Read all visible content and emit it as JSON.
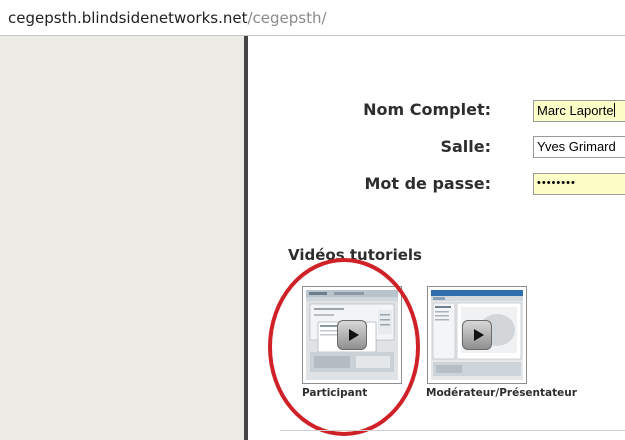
{
  "browser": {
    "url_host": "cegepsth.blindsidenetworks.net",
    "url_path": "/cegepsth/"
  },
  "login_form": {
    "full_name_label": "Nom Complet:",
    "full_name_value": "Marc Laporte",
    "room_label": "Salle:",
    "room_value": "Yves Grimard",
    "password_label": "Mot de passe:",
    "password_value": "••••••••",
    "input_highlight_color": "#fdfdc8"
  },
  "tutorials": {
    "title": "Vidéos tutoriels",
    "videos": [
      {
        "label": "Participant",
        "highlighted": true
      },
      {
        "label": "Modérateur/Présentateur",
        "highlighted": false
      }
    ],
    "highlight_color": "#cf2127"
  }
}
